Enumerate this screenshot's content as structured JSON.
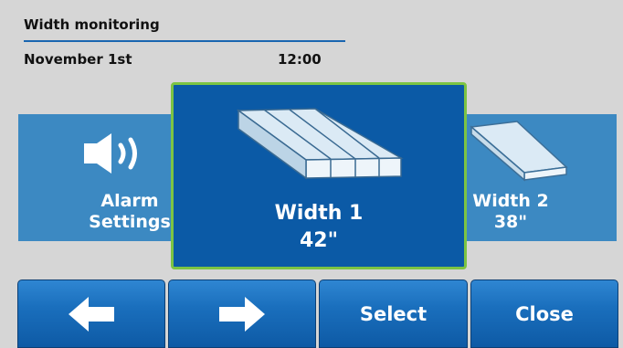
{
  "header": {
    "title": "Width monitoring",
    "date": "November 1st",
    "time": "12:00"
  },
  "carousel": {
    "items": [
      {
        "label_line1": "Alarm",
        "label_line2": "Settings",
        "icon": "speaker-icon"
      },
      {
        "label_line1": "Width 1",
        "label_line2": "42\"",
        "icon": "boards-icon",
        "selected": true
      },
      {
        "label_line1": "Width 2",
        "label_line2": "38\"",
        "icon": "board-icon"
      }
    ]
  },
  "toolbar": {
    "left_icon": "arrow-left-icon",
    "right_icon": "arrow-right-icon",
    "select_label": "Select",
    "close_label": "Close"
  },
  "colors": {
    "background": "#d6d6d6",
    "card": "#3c89c2",
    "card_selected": "#0b5aa6",
    "selected_border": "#7cc443",
    "divider": "#1a66b0",
    "button": "#1a6fbd"
  }
}
